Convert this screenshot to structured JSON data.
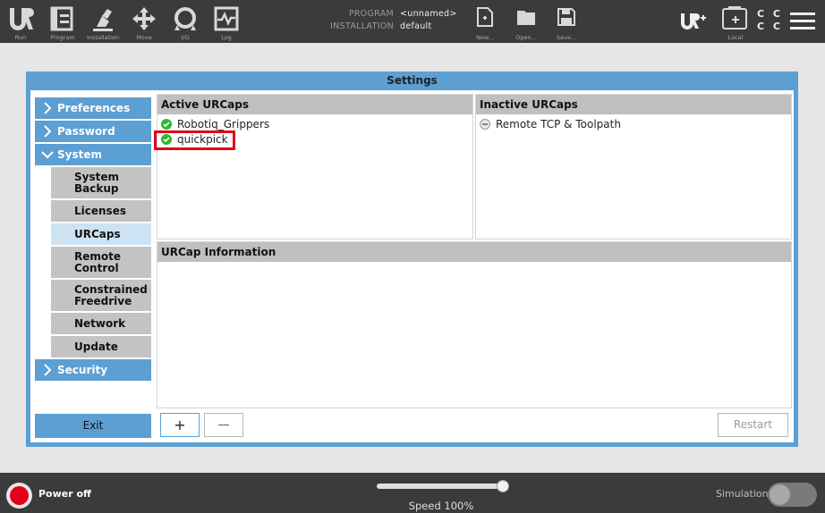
{
  "topbar": {
    "buttons": [
      {
        "label": "Run",
        "icon": "ur-logo-icon"
      },
      {
        "label": "Program",
        "icon": "program-icon"
      },
      {
        "label": "Installation",
        "icon": "installation-icon"
      },
      {
        "label": "Move",
        "icon": "move-icon"
      },
      {
        "label": "I/O",
        "icon": "io-icon"
      },
      {
        "label": "Log",
        "icon": "log-icon"
      }
    ],
    "program_key": "PROGRAM",
    "program_value": "<unnamed>",
    "installation_key": "INSTALLATION",
    "installation_value": "default",
    "file_buttons": [
      {
        "label": "New...",
        "icon": "new-file-icon"
      },
      {
        "label": "Open...",
        "icon": "open-folder-icon"
      },
      {
        "label": "Save...",
        "icon": "save-icon"
      }
    ],
    "urplus_icon": "ur-plus-icon",
    "local_label": "Local",
    "local_icon": "local-control-icon",
    "cc_line1": "C C",
    "cc_line2": "C C",
    "menu_icon": "hamburger-menu-icon"
  },
  "dialog": {
    "title": "Settings"
  },
  "nav": {
    "preferences": "Preferences",
    "password": "Password",
    "system": "System",
    "sub_items": [
      "System Backup",
      "Licenses",
      "URCaps",
      "Remote Control",
      "Constrained Freedrive",
      "Network",
      "Update"
    ],
    "active_sub_item": "URCaps",
    "security": "Security",
    "exit": "Exit"
  },
  "active_urcaps": {
    "header": "Active URCaps",
    "items": [
      {
        "name": "Robotiq_Grippers",
        "status": "active"
      },
      {
        "name": "quickpick",
        "status": "active"
      }
    ],
    "status_color": "#2eb82e"
  },
  "inactive_urcaps": {
    "header": "Inactive URCaps",
    "items": [
      {
        "name": "Remote TCP & Toolpath",
        "status": "inactive"
      }
    ]
  },
  "urcap_info": {
    "header": "URCap Information"
  },
  "actions": {
    "add": "+",
    "remove": "—",
    "restart": "Restart"
  },
  "bottombar": {
    "power_label": "Power off",
    "speed_label": "Speed 100%",
    "speed_percent": 100,
    "simulation_label": "Simulation",
    "simulation_on": false
  },
  "colors": {
    "accent": "#5b9fd3",
    "highlight": "#e2001a",
    "selected": "#cde3f3"
  }
}
